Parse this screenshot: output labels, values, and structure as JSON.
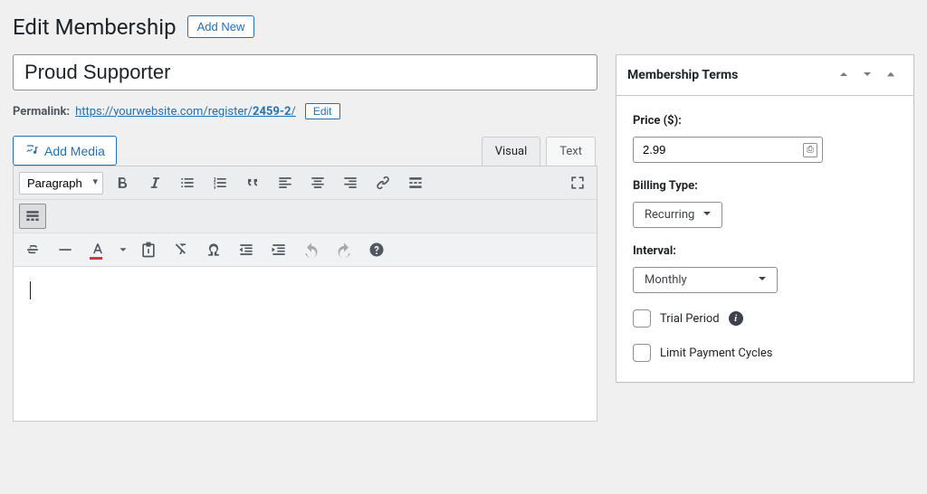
{
  "header": {
    "title": "Edit Membership",
    "add_new_label": "Add New"
  },
  "post": {
    "title_value": "Proud Supporter",
    "permalink_label": "Permalink:",
    "permalink_base": "https://yourwebsite.com/register/",
    "permalink_slug": "2459-2",
    "permalink_trail": "/",
    "edit_slug_label": "Edit"
  },
  "editor": {
    "add_media_label": "Add Media",
    "tabs": {
      "visual": "Visual",
      "text": "Text"
    },
    "format_select": "Paragraph"
  },
  "sidebar": {
    "terms_title": "Membership Terms",
    "price_label": "Price ($):",
    "price_value": "2.99",
    "billing_label": "Billing Type:",
    "billing_value": "Recurring",
    "interval_label": "Interval:",
    "interval_value": "Monthly",
    "trial_label": "Trial Period",
    "limit_label": "Limit Payment Cycles"
  }
}
